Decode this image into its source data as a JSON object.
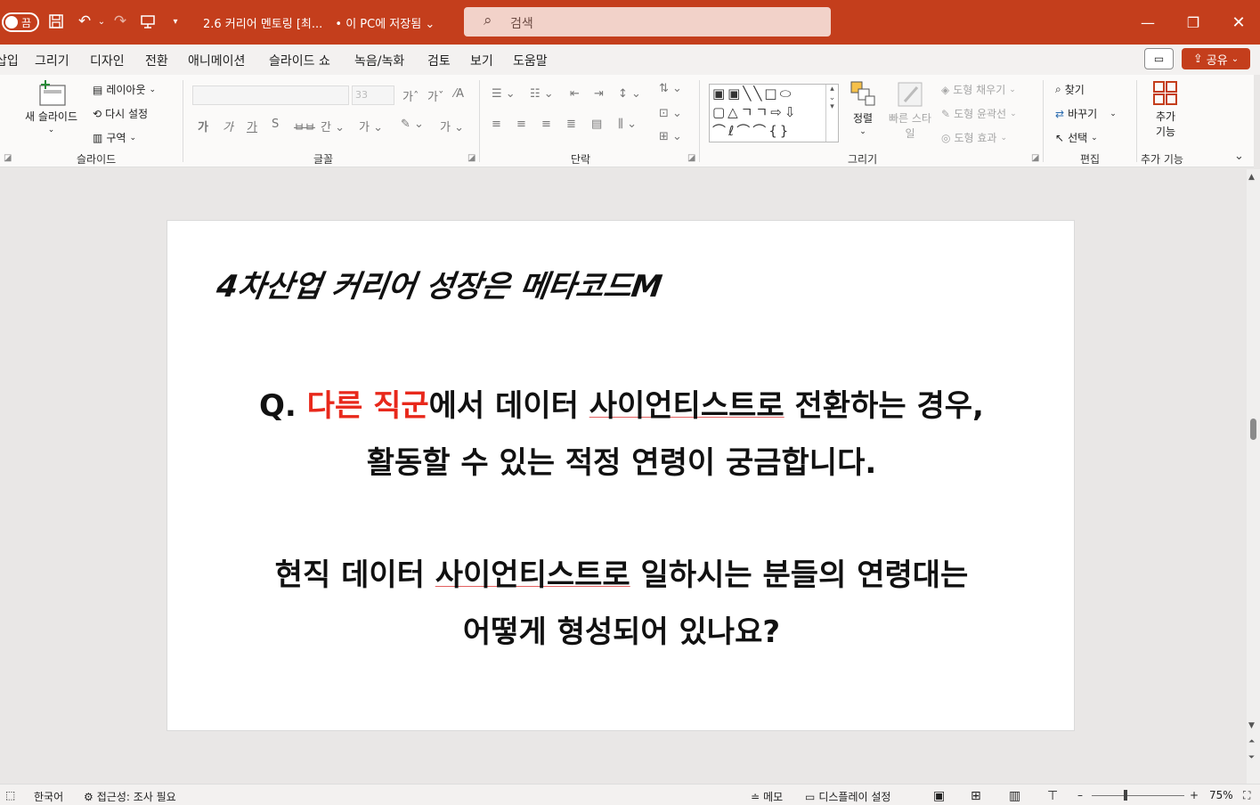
{
  "titlebar": {
    "autosave_label": "끔",
    "document_title": "2.6 커리어 멘토링 [최...",
    "save_status": "• 이 PC에 저장됨",
    "search_placeholder": "검색"
  },
  "menu": {
    "tabs": [
      "삽입",
      "그리기",
      "디자인",
      "전환",
      "애니메이션",
      "슬라이드 쇼",
      "녹음/녹화",
      "검토",
      "보기",
      "도움말"
    ],
    "share_label": "공유"
  },
  "ribbon": {
    "slides": {
      "new_slide": "새 슬라이드",
      "layout": "레이아웃",
      "reset": "다시 설정",
      "section": "구역",
      "group_label": "슬라이드"
    },
    "font": {
      "size": "33",
      "group_label": "글꼴"
    },
    "paragraph": {
      "group_label": "단락"
    },
    "drawing": {
      "arrange": "정렬",
      "quick_styles": "빠른 스타일",
      "shape_fill": "도형 채우기",
      "shape_outline": "도형 윤곽선",
      "shape_effects": "도형 효과",
      "group_label": "그리기"
    },
    "editing": {
      "find": "찾기",
      "replace": "바꾸기",
      "select": "선택",
      "group_label": "편집"
    },
    "addins": {
      "button": "추가 기능",
      "group_label": "추가 기능"
    }
  },
  "slide": {
    "title": "4차산업 커리어 성장은 메타코드M",
    "q_prefix": "Q. ",
    "q_red": "다른 직군",
    "q_rest_a": "에서 데이터 ",
    "q_squiggle1": "사이언티스트로",
    "q_rest_b": " 전환하는 경우,",
    "q_line2": "활동할 수 있는 적정 연령이 궁금합니다.",
    "a_start": "현직 데이터 ",
    "a_squiggle": "사이언티스트로",
    "a_rest": " 일하시는 분들의 연령대는",
    "a_line2": "어떻게 형성되어 있나요?"
  },
  "status": {
    "language": "한국어",
    "accessibility": "접근성: 조사 필요",
    "notes": "메모",
    "display_settings": "디스플레이 설정",
    "zoom": "75%"
  },
  "colors": {
    "accent": "#c43e1c",
    "highlight_red": "#e8281b"
  }
}
